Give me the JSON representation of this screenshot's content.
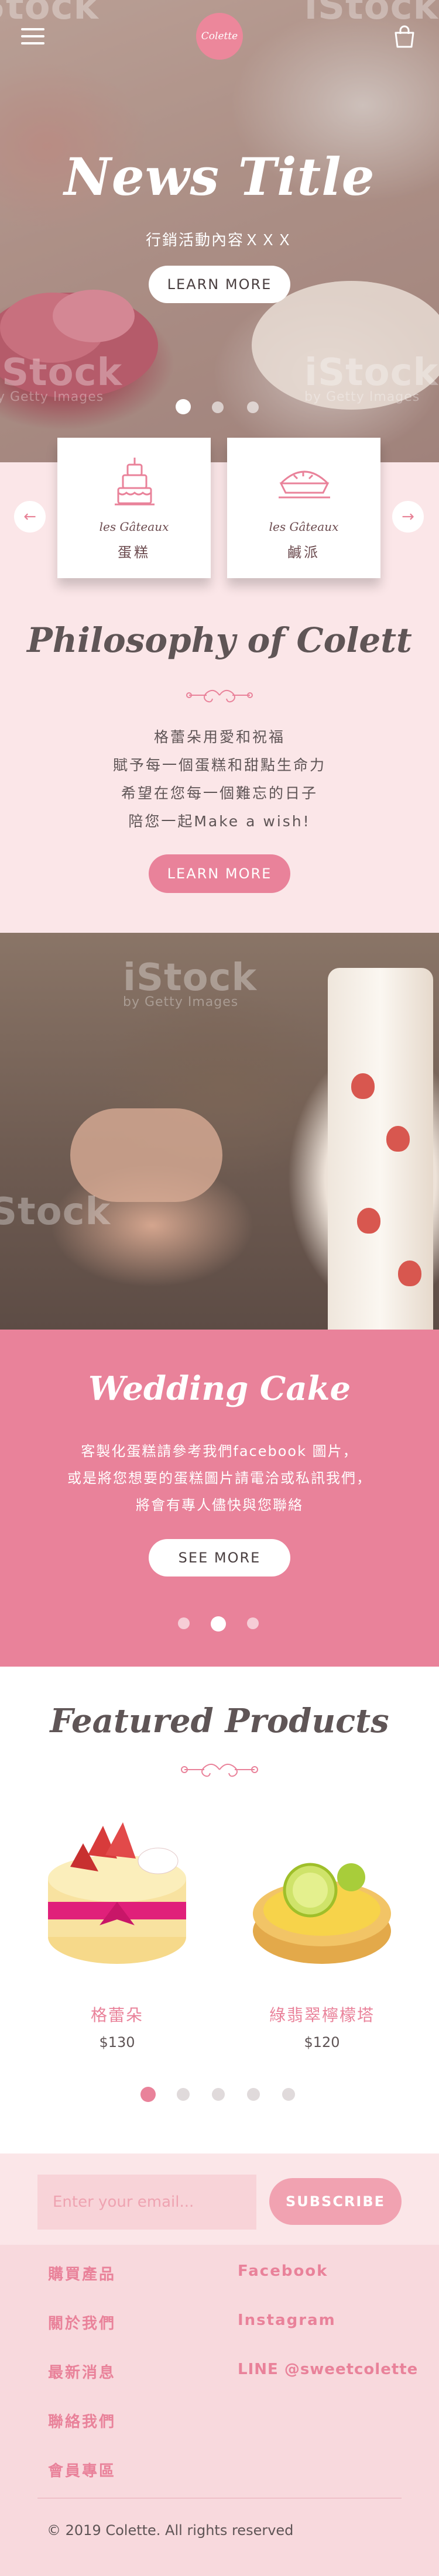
{
  "brand": {
    "logo_text": "Colette"
  },
  "hero": {
    "title": "News Title",
    "subtitle": "行銷活動內容ＸＸＸ",
    "button": "LEARN MORE",
    "watermark_main": "iStock",
    "watermark_sub": "by Getty Images",
    "slide_count": 3,
    "active_slide": 1
  },
  "categories": [
    {
      "fr": "les Gâteaux",
      "zh": "蛋糕",
      "icon": "cake-icon"
    },
    {
      "fr": "les Gâteaux",
      "zh": "鹹派",
      "icon": "pie-icon"
    }
  ],
  "philosophy": {
    "title": "Philosophy of Colett",
    "lines": [
      "格蕾朵用愛和祝福",
      "賦予每一個蛋糕和甜點生命力",
      "希望在您每一個難忘的日子",
      "陪您一起Make a wish!"
    ],
    "button": "LEARN MORE"
  },
  "wedding": {
    "watermark_main": "iStock",
    "watermark_sub": "by Getty Images",
    "title": "Wedding Cake",
    "lines": [
      "客製化蛋糕請參考我們facebook 圖片，",
      "或是將您想要的蛋糕圖片請電洽或私訊我們，",
      "將會有專人儘快與您聯絡"
    ],
    "button": "SEE MORE",
    "slide_count": 3,
    "active_slide": 2
  },
  "featured": {
    "title": "Featured Products",
    "products": [
      {
        "name": "格蕾朵",
        "price": "$130"
      },
      {
        "name": "綠翡翠檸檬塔",
        "price": "$120"
      }
    ],
    "page_count": 5,
    "active_page": 1
  },
  "subscribe": {
    "placeholder": "Enter your email...",
    "button": "SUBSCRIBE"
  },
  "footer": {
    "left_links": [
      "購買產品",
      "關於我們",
      "最新消息",
      "聯絡我們",
      "會員專區"
    ],
    "right_links": [
      "Facebook",
      "Instagram",
      "LINE @sweetcolette"
    ],
    "copyright": "© 2019 Colette. All rights reserved"
  },
  "colors": {
    "accent": "#e9829a",
    "text": "#5f5556",
    "bg": "#fbe6e8"
  }
}
